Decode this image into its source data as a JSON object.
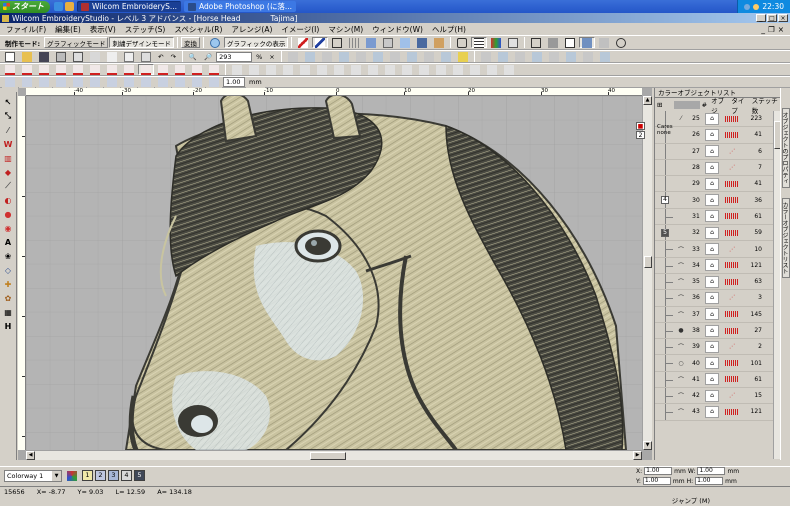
{
  "taskbar": {
    "start_label": "スタート",
    "tasks": [
      {
        "label": "Wilcom EmbroideryS...",
        "active": true
      },
      {
        "label": "Adobe Photoshop (に落...",
        "active": false
      }
    ],
    "clock": "22:30"
  },
  "window": {
    "title": "Wilcom EmbroideryStudio - レベル 3 アドバンス - [Horse Head",
    "title_suffix": "Tajima]"
  },
  "menu": {
    "items": [
      "ファイル(F)",
      "編集(E)",
      "表示(V)",
      "ステッチ(S)",
      "スペシャル(R)",
      "アレンジ(A)",
      "イメージ(I)",
      "マシン(M)",
      "ウィンドウ(W)",
      "ヘルプ(H)"
    ]
  },
  "toolbar1": {
    "mode_label": "制作モード:",
    "graphic_mode": "グラフィックモード",
    "detail_design_mode": "刺繍デザインモード",
    "convert": "変換",
    "show_graphics": "グラフィックの表示"
  },
  "toolbar2": {
    "zoom_value": "293",
    "zoom_unit": "%"
  },
  "toolbar4": {
    "spacing_value": "1.00",
    "unit": "mm"
  },
  "ruler": {
    "h_labels": [
      "-40",
      "-30",
      "-20",
      "-10",
      "0",
      "10",
      "20",
      "30",
      "40"
    ]
  },
  "panel": {
    "title": "カラーオブジェクトリスト",
    "header_object": "オブジ",
    "header_type": "タイプ",
    "header_count": "ステッチ数",
    "header_num": "#",
    "side_label_1": "オブジェクトのプロパティ",
    "side_label_2": "カラーオブジェクトリスト",
    "rows": [
      {
        "num": "25",
        "count": "223",
        "tree": "line",
        "type": "satin"
      },
      {
        "num": "26",
        "count": "41",
        "tree": "line",
        "type": "fill"
      },
      {
        "num": "27",
        "count": "6",
        "tree": "line",
        "type": "run"
      },
      {
        "num": "28",
        "count": "7",
        "tree": "line",
        "type": "run"
      },
      {
        "num": "29",
        "count": "41",
        "tree": "line",
        "type": "fill"
      },
      {
        "num": "30",
        "count": "36",
        "tree": "box",
        "box": "4",
        "type": "fill"
      },
      {
        "num": "31",
        "count": "61",
        "tree": "line",
        "type": "fill"
      },
      {
        "num": "32",
        "count": "59",
        "tree": "dark",
        "box": "5",
        "type": "fill"
      },
      {
        "num": "33",
        "count": "10",
        "tree": "line",
        "type": "run"
      },
      {
        "num": "34",
        "count": "121",
        "tree": "line",
        "type": "fill"
      },
      {
        "num": "35",
        "count": "63",
        "tree": "line",
        "type": "fill"
      },
      {
        "num": "36",
        "count": "3",
        "tree": "line",
        "type": "run"
      },
      {
        "num": "37",
        "count": "145",
        "tree": "line",
        "type": "fill"
      },
      {
        "num": "38",
        "count": "27",
        "tree": "line",
        "type": "fill"
      },
      {
        "num": "39",
        "count": "2",
        "tree": "line",
        "type": "run"
      },
      {
        "num": "40",
        "count": "101",
        "tree": "line",
        "type": "fill"
      },
      {
        "num": "41",
        "count": "61",
        "tree": "line",
        "type": "fill"
      },
      {
        "num": "42",
        "count": "15",
        "tree": "line",
        "type": "run"
      },
      {
        "num": "43",
        "count": "121",
        "tree": "line",
        "type": "fill"
      }
    ],
    "badge_top": "2",
    "side_tag": "Cares none"
  },
  "bottom": {
    "colorway": "Colorway 1",
    "swatches": [
      "1",
      "2",
      "3",
      "4",
      "5"
    ],
    "coord_x_label": "X:",
    "coord_y_label": "Y:",
    "coord_w_label": "W:",
    "coord_h_label": "H:",
    "coord_x": "1.00",
    "coord_y": "1.00",
    "coord_w": "1.00",
    "coord_h": "1.00",
    "unit": "mm"
  },
  "status": {
    "stitches": "15656",
    "x": "X= -8.77",
    "y": "Y= 9.03",
    "l": "L= 12.59",
    "a": "A= 134.18",
    "jump": "ジャンプ (M)"
  },
  "colors": {
    "canvas_bg": "#b4b4b4",
    "horse_body": "#c9c3a0",
    "mane": "#4a4a42",
    "highlight": "#dde6e8",
    "outline": "#3a3a34"
  }
}
